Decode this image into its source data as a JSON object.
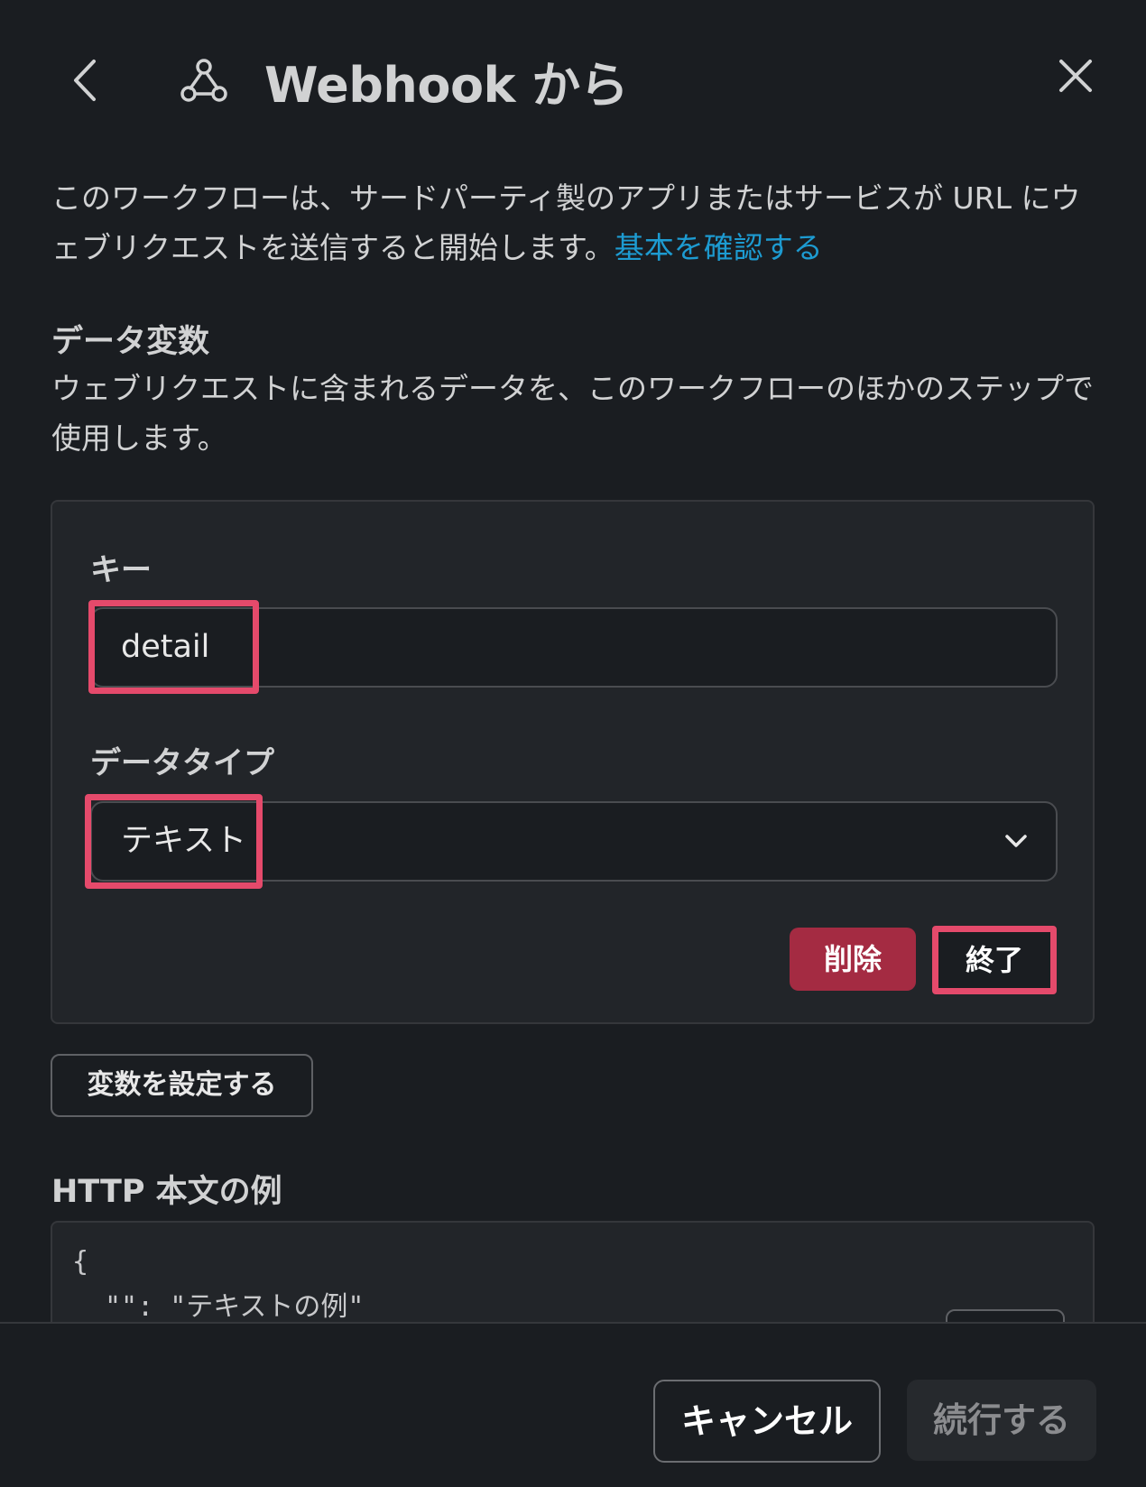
{
  "header": {
    "title": "Webhook から",
    "back_icon": "chevron-left-icon",
    "webhook_icon": "webhook-icon",
    "close_icon": "close-icon"
  },
  "intro": {
    "text": "このワークフローは、サードパーティ製のアプリまたはサービスが URL にウェブリクエストを送信すると開始します。",
    "link": "基本を確認する"
  },
  "data_variables": {
    "title": "データ変数",
    "description": "ウェブリクエストに含まれるデータを、このワークフローのほかのステップで使用します。",
    "key_label": "キー",
    "key_value": "detail",
    "type_label": "データタイプ",
    "type_value": "テキスト",
    "delete_label": "削除",
    "done_label": "終了",
    "set_variable_label": "変数を設定する"
  },
  "http_example": {
    "title": "HTTP 本文の例",
    "line1": "{",
    "line2": "\"\":  \"テキストの例\""
  },
  "footer": {
    "cancel_label": "キャンセル",
    "continue_label": "続行する"
  },
  "colors": {
    "background": "#1a1d21",
    "panel": "#222529",
    "link": "#1d9bd1",
    "danger": "#a42b42",
    "highlight": "#e54a6b"
  }
}
